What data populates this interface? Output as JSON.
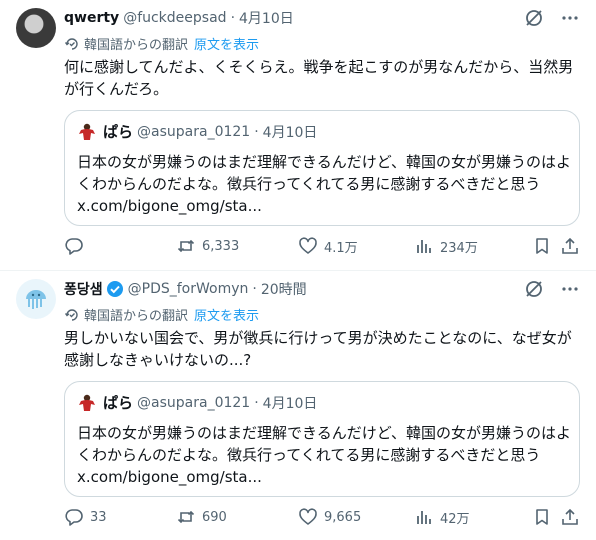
{
  "tweets": [
    {
      "name": "qwerty",
      "handle": "@fuckdeepsad",
      "dot": "·",
      "time": "4月10日",
      "translation_label": "韓国語からの翻訳",
      "show_original": "原文を表示",
      "text": "何に感謝してんだよ、くそくらえ。戦争を起こすのが男なんだから、当然男が行くんだろ。",
      "quote": {
        "name": "ぱら",
        "handle": "@asupara_0121",
        "dot": "·",
        "time": "4月10日",
        "text": "日本の女が男嫌うのはまだ理解できるんだけど、韓国の女が男嫌うのはよくわからんのだよな。徴兵行ってくれてる男に感謝するべきだと思う",
        "link": "x.com/bigone_omg/sta..."
      },
      "stats": {
        "replies": "",
        "retweets": "6,333",
        "likes": "4.1万",
        "views": "234万"
      }
    },
    {
      "name": "퐁당샘",
      "handle": "@PDS_forWomyn",
      "dot": "·",
      "time": "20時間",
      "translation_label": "韓国語からの翻訳",
      "show_original": "原文を表示",
      "text": "男しかいない国会で、男が徴兵に行けって男が決めたことなのに、なぜ女が感謝しなきゃいけないの...?",
      "quote": {
        "name": "ぱら",
        "handle": "@asupara_0121",
        "dot": "·",
        "time": "4月10日",
        "text": "日本の女が男嫌うのはまだ理解できるんだけど、韓国の女が男嫌うのはよくわからんのだよな。徴兵行ってくれてる男に感謝するべきだと思う",
        "link": "x.com/bigone_omg/sta..."
      },
      "stats": {
        "replies": "33",
        "retweets": "690",
        "likes": "9,665",
        "views": "42万"
      }
    }
  ],
  "colors": {
    "accent": "#1d9bf0",
    "secondary_text": "#536471",
    "border": "#cfd9de",
    "verified": "#1d9bf0"
  },
  "icons": [
    "grok-icon",
    "more-icon",
    "translate-icon",
    "reply-icon",
    "retweet-icon",
    "like-icon",
    "views-icon",
    "bookmark-icon",
    "share-icon",
    "verified-icon"
  ]
}
